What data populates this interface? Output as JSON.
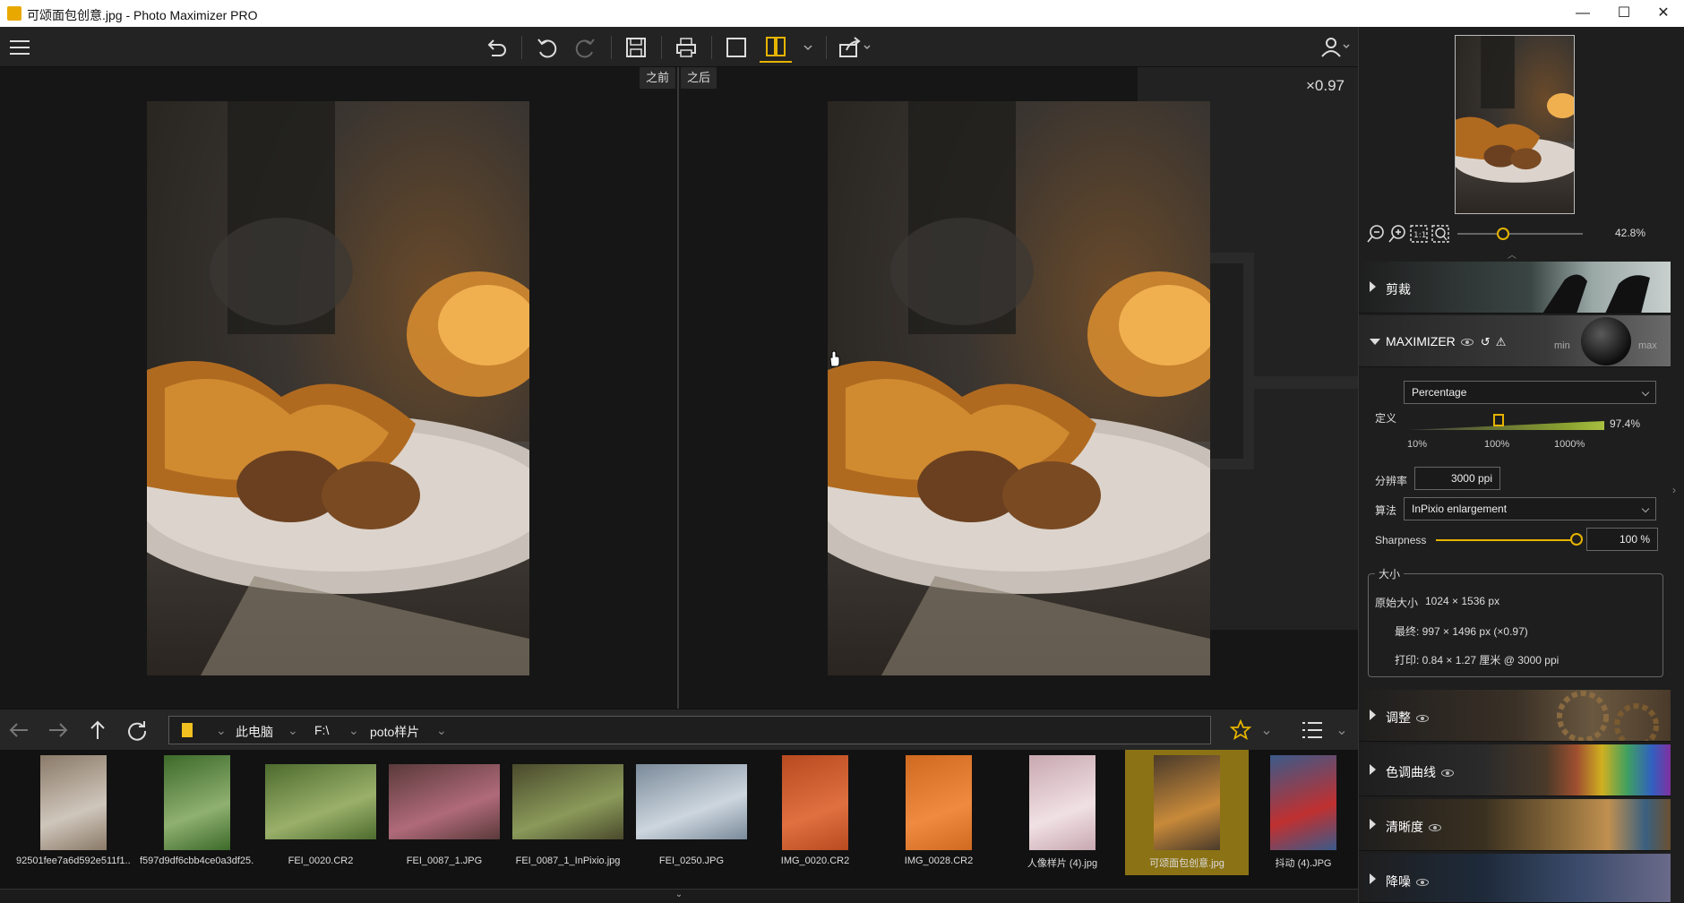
{
  "window": {
    "title": "可颂面包创意.jpg - Photo Maximizer PRO",
    "controls": [
      "—",
      "☐",
      "✕"
    ]
  },
  "viewer": {
    "before_label": "之前",
    "after_label": "之后",
    "zoom": "×0.97"
  },
  "navigation": {
    "path": {
      "root": "此电脑",
      "drive": "F:\\",
      "folder": "poto样片"
    }
  },
  "thumbnails": [
    {
      "label": "92501fee7a6d592e511f1...",
      "colors": [
        "#8a7a68",
        "#cfc6bb"
      ]
    },
    {
      "label": "f597d9df6cbb4ce0a3df25...",
      "colors": [
        "#3c6a2a",
        "#8fb070"
      ]
    },
    {
      "label": "FEI_0020.CR2",
      "colors": [
        "#4d6b2e",
        "#9ab06a"
      ]
    },
    {
      "label": "FEI_0087_1.JPG",
      "colors": [
        "#5a3a3a",
        "#b06a7a"
      ]
    },
    {
      "label": "FEI_0087_1_InPixio.jpg",
      "colors": [
        "#4a4a2c",
        "#8a9a5a"
      ]
    },
    {
      "label": "FEI_0250.JPG",
      "colors": [
        "#7a8a9a",
        "#cdd6de"
      ]
    },
    {
      "label": "IMG_0020.CR2",
      "colors": [
        "#b84a20",
        "#e07040"
      ]
    },
    {
      "label": "IMG_0028.CR2",
      "colors": [
        "#d06a20",
        "#f08a40"
      ]
    },
    {
      "label": "人像样片 (4).jpg",
      "colors": [
        "#c8a8b0",
        "#f0e0e4"
      ]
    },
    {
      "label": "可颂面包创意.jpg",
      "colors": [
        "#4a3a2a",
        "#c88a3a"
      ]
    },
    {
      "label": "抖动 (4).JPG",
      "colors": [
        "#3a5a8a",
        "#c03030"
      ]
    }
  ],
  "panel": {
    "navigator_zoom": "42.8%",
    "sections": {
      "crop": "剪裁",
      "maximizer": "MAXIMIZER",
      "adjust": "调整",
      "curves": "色调曲线",
      "clarity": "清晰度",
      "denoise": "降噪"
    },
    "maximizer": {
      "mode": "Percentage",
      "definition_label": "定义",
      "definition_value": "97.4%",
      "ticks": [
        "10%",
        "100%",
        "1000%"
      ],
      "resolution_label": "分辨率",
      "resolution_value": "3000 ppi",
      "algorithm_label": "算法",
      "algorithm_value": "InPixio enlargement",
      "sharpness_label": "Sharpness",
      "sharpness_value": "100 %",
      "knob_min": "min",
      "knob_max": "max"
    },
    "size": {
      "title": "大小",
      "original_label": "原始大小",
      "original_value": "1024 × 1536 px",
      "final": "最终: 997 × 1496 px (×0.97)",
      "print": "打印: 0.84 × 1.27 厘米 @ 3000 ppi"
    }
  }
}
